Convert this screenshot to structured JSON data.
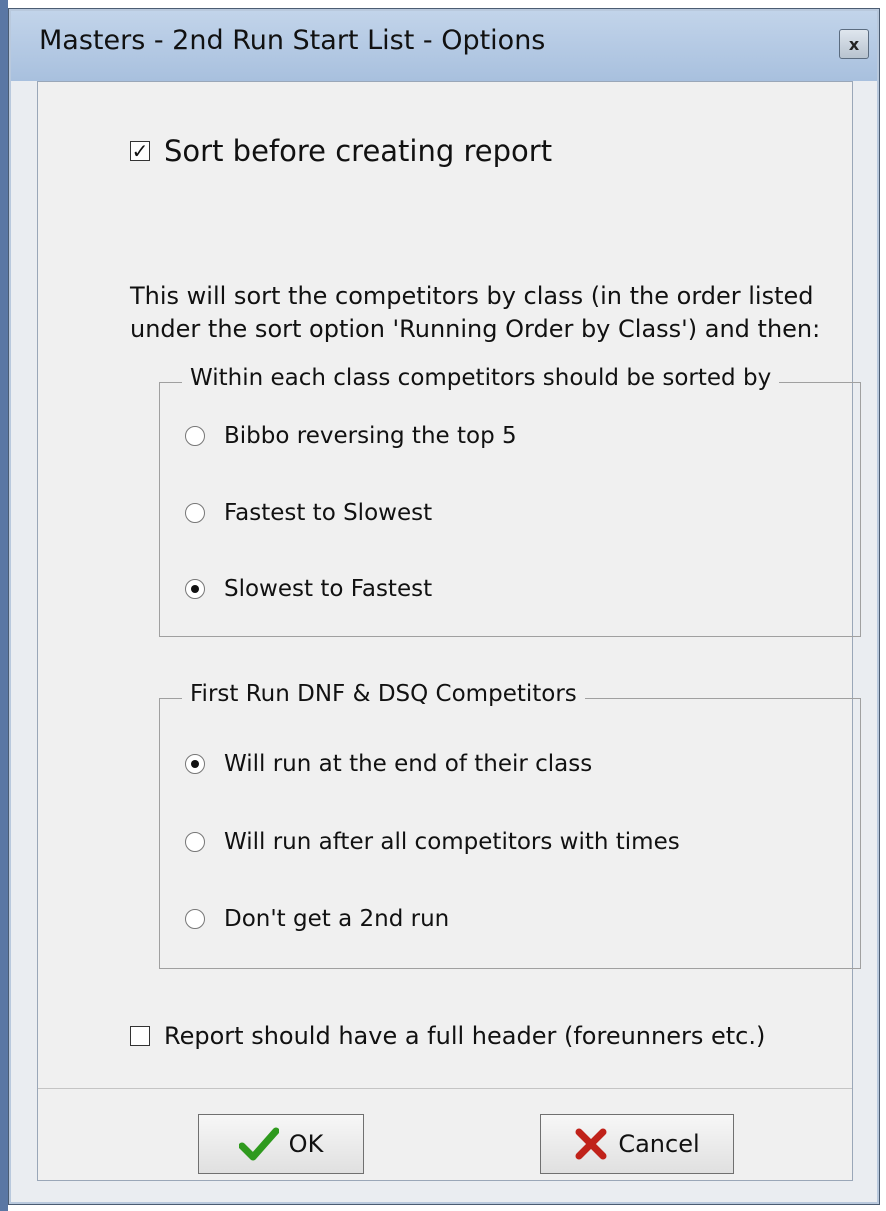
{
  "window": {
    "title": "Masters - 2nd Run Start List - Options",
    "close_glyph": "x"
  },
  "sort_option": {
    "label": "Sort before creating report",
    "checked": true
  },
  "description": "This will sort the competitors by class (in the order listed under the sort option 'Running Order by Class') and then:",
  "within_class_group": {
    "legend": "Within each class competitors should be sorted  by",
    "options": [
      {
        "label": "Bibbo reversing the top 5",
        "selected": false
      },
      {
        "label": "Fastest to Slowest",
        "selected": false
      },
      {
        "label": "Slowest to Fastest",
        "selected": true
      }
    ]
  },
  "dnf_group": {
    "legend": "First Run DNF & DSQ Competitors",
    "options": [
      {
        "label": "Will run at the end of their class",
        "selected": true
      },
      {
        "label": "Will run after all competitors with times",
        "selected": false
      },
      {
        "label": "Don't get a 2nd run",
        "selected": false
      }
    ]
  },
  "header_option": {
    "label": "Report should have a full header (foreunners etc.)",
    "checked": false
  },
  "buttons": {
    "ok": {
      "label": "OK",
      "icon": "checkmark-icon",
      "icon_color": "#2f9a1e"
    },
    "cancel": {
      "label": "Cancel",
      "icon": "x-mark-icon",
      "icon_color": "#c0221a"
    }
  }
}
